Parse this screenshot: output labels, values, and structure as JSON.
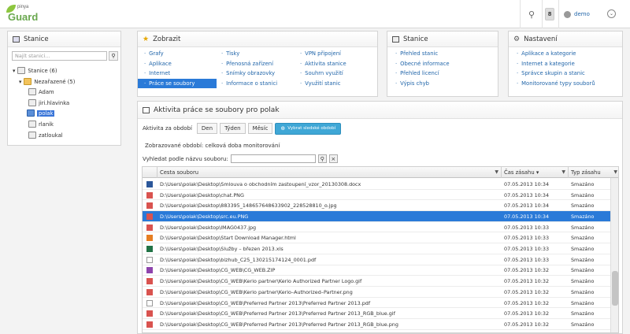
{
  "app": {
    "logo_small": "pinya",
    "logo_big": "Guard"
  },
  "topbar": {
    "badge": "8",
    "user_name": "demo"
  },
  "stanice": {
    "title": "Stanice",
    "search_placeholder": "Najít stanici...",
    "root": "Stanice (6)",
    "group": "Nezařazené (5)",
    "items": [
      "Adam",
      "jiri.hlavinka",
      "polak",
      "rlanik",
      "zatloukal"
    ],
    "selected": "polak"
  },
  "menu_zobrazit": {
    "title": "Zobrazit",
    "col1": [
      "Grafy",
      "Aplikace",
      "Internet",
      "Práce se soubory"
    ],
    "col2": [
      "Tisky",
      "Přenosná zařízení",
      "Snímky obrazovky",
      "Informace o stanici"
    ],
    "col3": [
      "VPN připojení",
      "Aktivita stanice",
      "Souhrn využití",
      "Využití stanic"
    ],
    "active": "Práce se soubory"
  },
  "menu_stanice": {
    "title": "Stanice",
    "items": [
      "Přehled stanic",
      "Obecné informace",
      "Přehled licencí",
      "Výpis chyb"
    ]
  },
  "menu_nastaveni": {
    "title": "Nastavení",
    "items": [
      "Aplikace a kategorie",
      "Internet a kategorie",
      "Správce skupin a stanic",
      "Monitorované typy souborů"
    ]
  },
  "main": {
    "title": "Aktivita práce se soubory pro polak",
    "period_label": "Aktivita za období",
    "periods": [
      "Den",
      "Týden",
      "Měsíc"
    ],
    "show_button": "Vybrat sledské období",
    "period_info": "Zobrazované období: celková doba monitorování",
    "search_label": "Vyhledat podle názvu souboru:"
  },
  "grid": {
    "columns": {
      "path": "Cesta souboru",
      "time": "Čas zásahu ▾",
      "type": "Typ zásahu"
    },
    "rows": [
      {
        "path": "D:\\Users\\polak\\Desktop\\Smlouva o obchodním zastoupení_vzor_20130308.docx",
        "time": "07.05.2013 10:34",
        "type": "Smazáno",
        "icon": "word-icon",
        "color": "#2b579a"
      },
      {
        "path": "D:\\Users\\polak\\Desktop\\chat.PNG",
        "time": "07.05.2013 10:34",
        "type": "Smazáno",
        "icon": "image-icon",
        "color": "#d9534f"
      },
      {
        "path": "D:\\Users\\polak\\Desktop\\883395_148657648633902_228528810_o.jpg",
        "time": "07.05.2013 10:34",
        "type": "Smazáno",
        "icon": "image-icon",
        "color": "#d9534f"
      },
      {
        "path": "D:\\Users\\polak\\Desktop\\src.eu.PNG",
        "time": "07.05.2013 10:34",
        "type": "Smazáno",
        "icon": "image-icon",
        "color": "#d9534f"
      },
      {
        "path": "D:\\Users\\polak\\Desktop\\IMAG0437.jpg",
        "time": "07.05.2013 10:33",
        "type": "Smazáno",
        "icon": "image-icon",
        "color": "#d9534f"
      },
      {
        "path": "D:\\Users\\polak\\Desktop\\Start Download Manager.html",
        "time": "07.05.2013 10:33",
        "type": "Smazáno",
        "icon": "html-icon",
        "color": "#e67e22"
      },
      {
        "path": "D:\\Users\\polak\\Desktop\\Služby – březen 2013.xls",
        "time": "07.05.2013 10:33",
        "type": "Smazáno",
        "icon": "excel-icon",
        "color": "#217346"
      },
      {
        "path": "D:\\Users\\polak\\Desktop\\bizhub_C25_130215174124_0001.pdf",
        "time": "07.05.2013 10:33",
        "type": "Smazáno",
        "icon": "generic-file-icon",
        "color": "#ffffff"
      },
      {
        "path": "D:\\Users\\polak\\Desktop\\CG_WEB\\CG_WEB.ZIP",
        "time": "07.05.2013 10:32",
        "type": "Smazáno",
        "icon": "zip-icon",
        "color": "#8e44ad"
      },
      {
        "path": "D:\\Users\\polak\\Desktop\\CG_WEB\\Kerio partner\\Kerio Authorized Partner Logo.gif",
        "time": "07.05.2013 10:32",
        "type": "Smazáno",
        "icon": "image-icon",
        "color": "#d9534f"
      },
      {
        "path": "D:\\Users\\polak\\Desktop\\CG_WEB\\Kerio partner\\Kerio–Authorized–Partner.png",
        "time": "07.05.2013 10:32",
        "type": "Smazáno",
        "icon": "image-icon",
        "color": "#d9534f"
      },
      {
        "path": "D:\\Users\\polak\\Desktop\\CG_WEB\\Preferred Partner 2013\\Preferred Partner 2013.pdf",
        "time": "07.05.2013 10:32",
        "type": "Smazáno",
        "icon": "generic-file-icon",
        "color": "#ffffff"
      },
      {
        "path": "D:\\Users\\polak\\Desktop\\CG_WEB\\Preferred Partner 2013\\Preferred Partner 2013_RGB_blue.gif",
        "time": "07.05.2013 10:32",
        "type": "Smazáno",
        "icon": "image-icon",
        "color": "#d9534f"
      },
      {
        "path": "D:\\Users\\polak\\Desktop\\CG_WEB\\Preferred Partner 2013\\Preferred Partner 2013_RGB_blue.png",
        "time": "07.05.2013 10:32",
        "type": "Smazáno",
        "icon": "image-icon",
        "color": "#d9534f"
      }
    ],
    "selected_row": 3
  },
  "colors": {
    "accent": "#2a7ad8",
    "link": "#2266aa",
    "button": "#3fa7d6"
  }
}
